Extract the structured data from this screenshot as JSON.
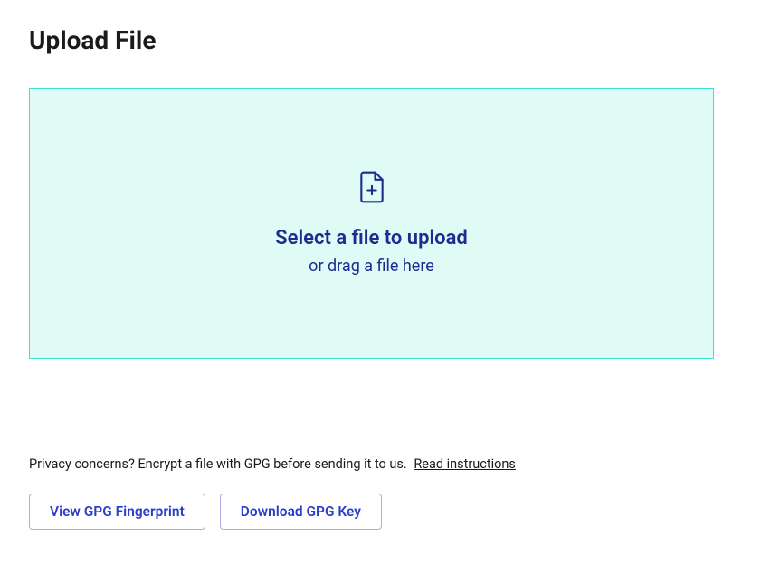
{
  "page": {
    "title": "Upload File"
  },
  "dropzone": {
    "primary_text": "Select a file to upload",
    "secondary_text": "or drag a file here",
    "icon": "file-plus-icon"
  },
  "privacy": {
    "text": "Privacy concerns? Encrypt a file with GPG before sending it to us.",
    "link_text": "Read instructions"
  },
  "buttons": {
    "view_fingerprint": "View GPG Fingerprint",
    "download_key": "Download GPG Key"
  }
}
